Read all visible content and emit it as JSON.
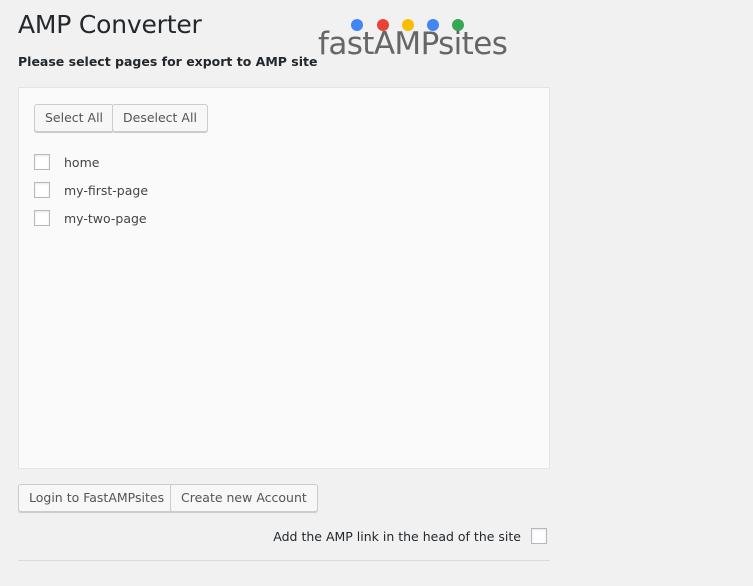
{
  "header": {
    "title": "AMP Converter",
    "subtitle": "Please select pages for export to AMP site"
  },
  "logo": {
    "text": "fastAMPsites",
    "dot_colors": [
      "#4285f4",
      "#ea4335",
      "#fbbc05",
      "#4285f4",
      "#34a853"
    ]
  },
  "panel": {
    "select_all_label": "Select All",
    "deselect_all_label": "Deselect All",
    "pages": [
      {
        "label": "home",
        "checked": false
      },
      {
        "label": "my-first-page",
        "checked": false
      },
      {
        "label": "my-two-page",
        "checked": false
      }
    ]
  },
  "footer": {
    "login_label": "Login to FastAMPsites",
    "create_account_label": "Create new Account",
    "amp_link_option_label": "Add the AMP link in the head of the site",
    "amp_link_checked": false
  }
}
